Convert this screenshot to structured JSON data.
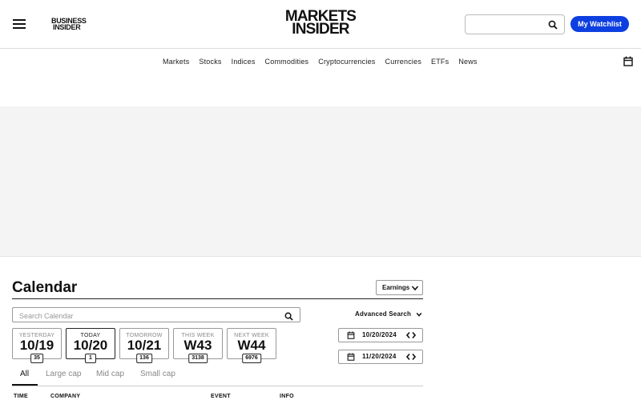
{
  "header": {
    "menu_icon": "hamburger-menu-icon",
    "bi_logo_line1": "BUSINESS",
    "bi_logo_line2": "INSIDER",
    "mi_logo_line1": "MARKETS",
    "mi_logo_line2": "INSIDER",
    "search_value": "",
    "search_icon": "search-icon",
    "watchlist_label": "My Watchlist",
    "accent_color": "#0d3fe0"
  },
  "nav": {
    "items": [
      "Markets",
      "Stocks",
      "Indices",
      "Commodities",
      "Cryptocurrencies",
      "Currencies",
      "ETFs",
      "News"
    ],
    "calendar_icon": "calendar-icon"
  },
  "calendar": {
    "title": "Calendar",
    "type_select": "Earnings",
    "search_placeholder": "Search Calendar",
    "advanced_search": "Advanced Search",
    "days": [
      {
        "label": "YESTERDAY",
        "value": "10/19",
        "count": "35",
        "active": false
      },
      {
        "label": "TODAY",
        "value": "10/20",
        "count": "1",
        "active": true
      },
      {
        "label": "TOMORROW",
        "value": "10/21",
        "count": "136",
        "active": false
      },
      {
        "label": "THIS WEEK",
        "value": "W43",
        "count": "3138",
        "active": false
      },
      {
        "label": "NEXT WEEK",
        "value": "W44",
        "count": "6976",
        "active": false
      }
    ],
    "date_from": "10/20/2024",
    "date_to": "11/20/2024",
    "cap_tabs": [
      "All",
      "Large cap",
      "Mid cap",
      "Small cap"
    ],
    "active_cap_tab": "All",
    "columns": [
      "TIME",
      "COMPANY",
      "EVENT",
      "INFO"
    ]
  }
}
